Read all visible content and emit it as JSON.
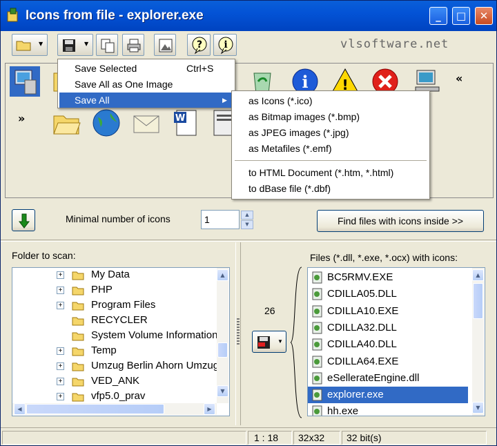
{
  "window": {
    "title": "Icons from file - explorer.exe"
  },
  "titlebar": {
    "minimize": "_",
    "maximize": "□",
    "close": "✕"
  },
  "toolbar": {
    "brand": "vlsoftware.net"
  },
  "icon_panel": {
    "nav_prev": "«",
    "nav_next": "»"
  },
  "middle": {
    "min_icons_label": "Minimal number of icons",
    "min_icons_value": "1",
    "find_button": "Find files with icons inside >>"
  },
  "left_pane": {
    "label": "Folder to scan:",
    "folders": [
      {
        "name": "My Data",
        "expandable": true
      },
      {
        "name": "PHP",
        "expandable": true
      },
      {
        "name": "Program Files",
        "expandable": true
      },
      {
        "name": "RECYCLER",
        "expandable": false
      },
      {
        "name": "System Volume Information",
        "expandable": false
      },
      {
        "name": "Temp",
        "expandable": true
      },
      {
        "name": "Umzug Berlin Ahorn Umzug",
        "expandable": true
      },
      {
        "name": "VED_ANK",
        "expandable": true
      },
      {
        "name": "vfp5.0_prav",
        "expandable": true
      }
    ]
  },
  "right_pane": {
    "label": "Files (*.dll, *.exe, *.ocx) with icons:",
    "count": "26",
    "files": [
      {
        "name": "BC5RMV.EXE",
        "selected": false
      },
      {
        "name": "CDILLA05.DLL",
        "selected": false
      },
      {
        "name": "CDILLA10.EXE",
        "selected": false
      },
      {
        "name": "CDILLA32.DLL",
        "selected": false
      },
      {
        "name": "CDILLA40.DLL",
        "selected": false
      },
      {
        "name": "CDILLA64.EXE",
        "selected": false
      },
      {
        "name": "eSellerateEngine.dll",
        "selected": false
      },
      {
        "name": "explorer.exe",
        "selected": true
      },
      {
        "name": "hh.exe",
        "selected": false
      }
    ]
  },
  "statusbar": {
    "ratio": "1 : 18",
    "size": "32x32",
    "depth": "32 bit(s)"
  },
  "save_menu": {
    "items": [
      {
        "label": "Save Selected",
        "shortcut": "Ctrl+S"
      },
      {
        "label": "Save All as One Image",
        "shortcut": ""
      },
      {
        "label": "Save All",
        "shortcut": "▶"
      }
    ]
  },
  "save_all_submenu": {
    "items": [
      "as Icons (*.ico)",
      "as Bitmap images (*.bmp)",
      "as JPEG images (*.jpg)",
      "as Metafiles (*.emf)",
      "to HTML Document (*.htm, *.html)",
      "to dBase file (*.dbf)"
    ]
  },
  "colors": {
    "title_blue": "#0353d6",
    "selection": "#316ac5",
    "face": "#ece9d8"
  }
}
